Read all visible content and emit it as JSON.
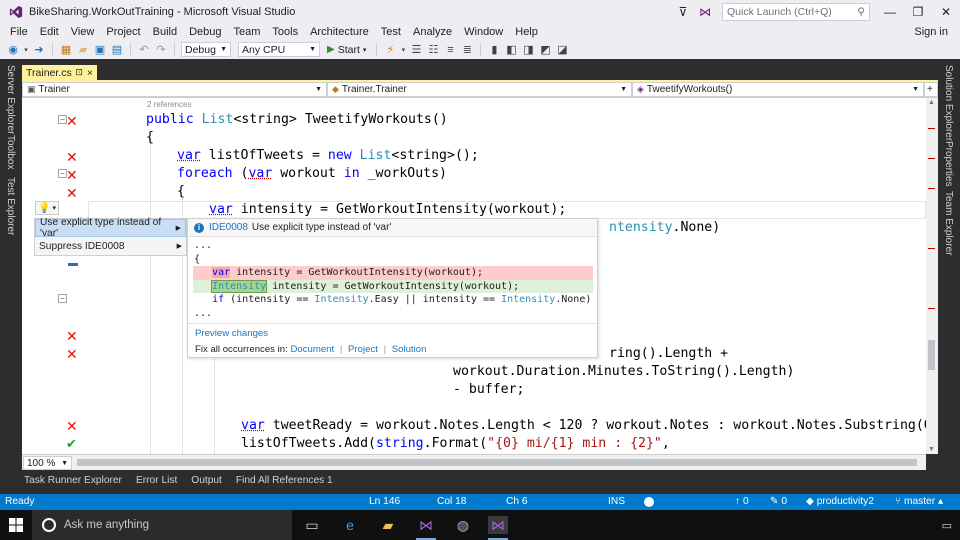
{
  "window": {
    "title": "BikeSharing.WorkOutTraining - Microsoft Visual Studio",
    "quick_launch_placeholder": "Quick Launch (Ctrl+Q)",
    "sign_in": "Sign in"
  },
  "menu": [
    "File",
    "Edit",
    "View",
    "Project",
    "Build",
    "Debug",
    "Team",
    "Tools",
    "Architecture",
    "Test",
    "Analyze",
    "Window",
    "Help"
  ],
  "toolbar": {
    "config": "Debug",
    "platform": "Any CPU",
    "start_label": "Start"
  },
  "left_panels": [
    "Server Explorer",
    "Toolbox",
    "Test Explorer"
  ],
  "right_panels": [
    "Solution Explorer",
    "Properties",
    "Team Explorer"
  ],
  "document_tab": {
    "name": "Trainer.cs",
    "pin": "⊡",
    "close": "×"
  },
  "navbar": {
    "project": "Trainer",
    "type": "Trainer.Trainer",
    "member": "TweetifyWorkouts()"
  },
  "code": {
    "refs": "2 references",
    "l1_kw": "public",
    "l1_ty": "List",
    "l1_rest": "<string> TweetifyWorkouts()",
    "l2": "{",
    "l3_kw": "var",
    "l3_a": " listOfTweets = ",
    "l3_new": "new",
    "l3_sp": " ",
    "l3_ty": "List",
    "l3_b": "<string>();",
    "l4_kw": "foreach",
    "l4_a": " (",
    "l4_var": "var",
    "l4_b": " workout ",
    "l4_in": "in",
    "l4_c": " _workOuts)",
    "l5": "{",
    "l6_kw": "var",
    "l6_rest": " intensity = GetWorkoutIntensity(workout);",
    "l7_ty": "ntensity",
    "l7_rest": ".None)",
    "l8_a": "ring().Length +",
    "l9": "workout.Duration.Minutes.ToString().Length)",
    "l10": "- buffer;",
    "l11_kw": "var",
    "l11_rest": " tweetReady = workout.Notes.Length < 120 ? workout.Notes : workout.Notes.Substring(0",
    "l12_a": "listOfTweets.Add(",
    "l12_kw": "string",
    "l12_b": ".Format(",
    "l12_str": "\"{0} mi/{1} min : {2}\"",
    "l12_c": ","
  },
  "quick_actions": {
    "item1": "Use explicit type instead of 'var'",
    "item2": "Suppress IDE0008",
    "arrow": "▶"
  },
  "preview": {
    "id": "IDE0008",
    "title": "Use explicit type instead of 'var'",
    "dots1": "...",
    "brace": "{",
    "del_kw": "var",
    "del_rest": " intensity = GetWorkoutIntensity(workout);",
    "add_ty": "Intensity",
    "add_rest": " intensity = GetWorkoutIntensity(workout);",
    "if_kw": "if",
    "if_a": " (intensity == ",
    "if_t1": "Intensity",
    "if_b": ".Easy || intensity == ",
    "if_t2": "Intensity",
    "if_c": ".None)",
    "dots2": "...",
    "preview_changes": "Preview changes",
    "fix_all": "Fix all occurrences in:",
    "scope_document": "Document",
    "scope_project": "Project",
    "scope_solution": "Solution"
  },
  "zoom": "100 %",
  "tool_tabs": [
    "Task Runner Explorer",
    "Error List",
    "Output",
    "Find All References 1"
  ],
  "status": {
    "ready": "Ready",
    "ln": "Ln 146",
    "col": "Col 18",
    "ch": "Ch 6",
    "ins": "INS",
    "up": "0",
    "pencil": "0",
    "repo": "productivity2",
    "branch": "master"
  },
  "taskbar": {
    "search_placeholder": "Ask me anything"
  },
  "colors": {
    "accent": "#007acc",
    "keyword": "#0000ff",
    "type": "#2b91af",
    "string": "#a31515",
    "error_glyph": "#e51400",
    "ok_glyph": "#1e9e3b"
  }
}
